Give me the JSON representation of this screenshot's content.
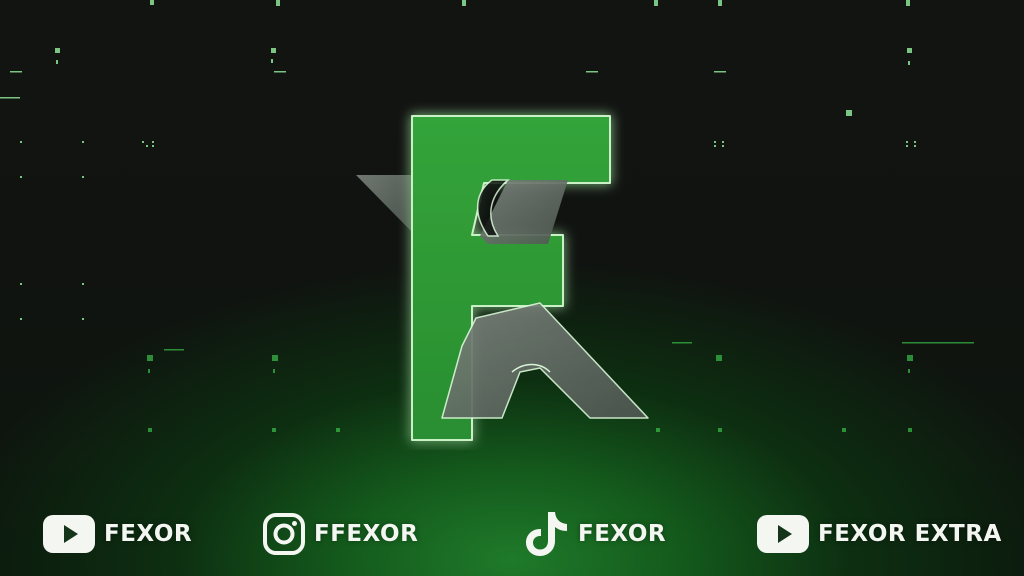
{
  "background": {
    "base_color": "#101210",
    "glow_color": "#1f7a2a",
    "particle_color": "#7ee08a"
  },
  "logo": {
    "icon": "fexor-f-logo-icon",
    "primary_color": "#2e9a35",
    "secondary_color": "#5f6a61",
    "edge_color": "#d8f5d6"
  },
  "socials": [
    {
      "platform": "youtube",
      "icon": "youtube-icon",
      "label": "FEXOR"
    },
    {
      "platform": "instagram",
      "icon": "instagram-icon",
      "label": "FFEXOR"
    },
    {
      "platform": "tiktok",
      "icon": "tiktok-icon",
      "label": "FEXOR"
    },
    {
      "platform": "youtube",
      "icon": "youtube-icon",
      "label": "FEXOR EXTRA"
    }
  ]
}
